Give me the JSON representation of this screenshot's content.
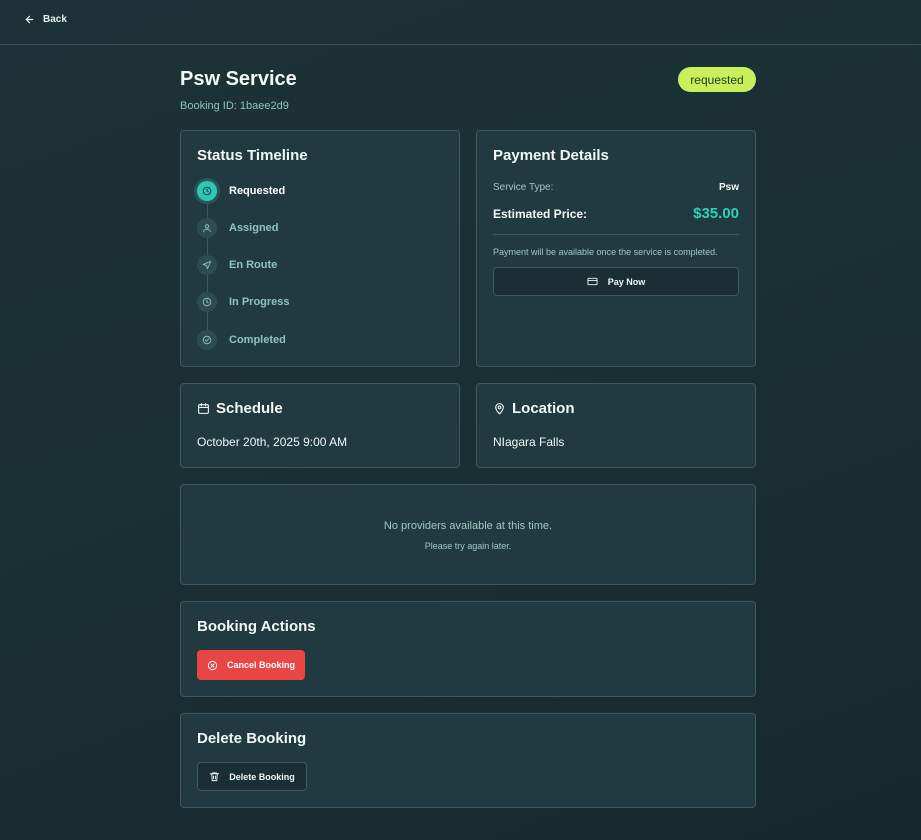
{
  "nav": {
    "back_label": "Back"
  },
  "header": {
    "title": "Psw Service",
    "booking_id": "Booking ID: 1baee2d9",
    "status": "requested"
  },
  "colors": {
    "accent": "#2fc7b1",
    "status_badge": "#c9ef5a",
    "danger": "#e84545"
  },
  "timeline": {
    "title": "Status Timeline",
    "steps": [
      {
        "label": "Requested",
        "icon": "clock-icon",
        "active": true
      },
      {
        "label": "Assigned",
        "icon": "user-icon",
        "active": false
      },
      {
        "label": "En Route",
        "icon": "navigation-icon",
        "active": false
      },
      {
        "label": "In Progress",
        "icon": "clock-icon",
        "active": false
      },
      {
        "label": "Completed",
        "icon": "check-circle-icon",
        "active": false
      }
    ]
  },
  "payment": {
    "title": "Payment Details",
    "service_type_label": "Service Type:",
    "service_type_value": "Psw",
    "price_label": "Estimated Price:",
    "price_value": "$35.00",
    "note": "Payment will be available once the service is completed.",
    "pay_button": "Pay Now"
  },
  "schedule": {
    "title": "Schedule",
    "value": "October 20th, 2025 9:00 AM"
  },
  "location": {
    "title": "Location",
    "value": "NIagara Falls"
  },
  "providers": {
    "message": "No providers available at this time.",
    "sub": "Please try again later."
  },
  "actions": {
    "title": "Booking Actions",
    "cancel_button": "Cancel Booking"
  },
  "delete": {
    "title": "Delete Booking",
    "delete_button": "Delete Booking"
  }
}
